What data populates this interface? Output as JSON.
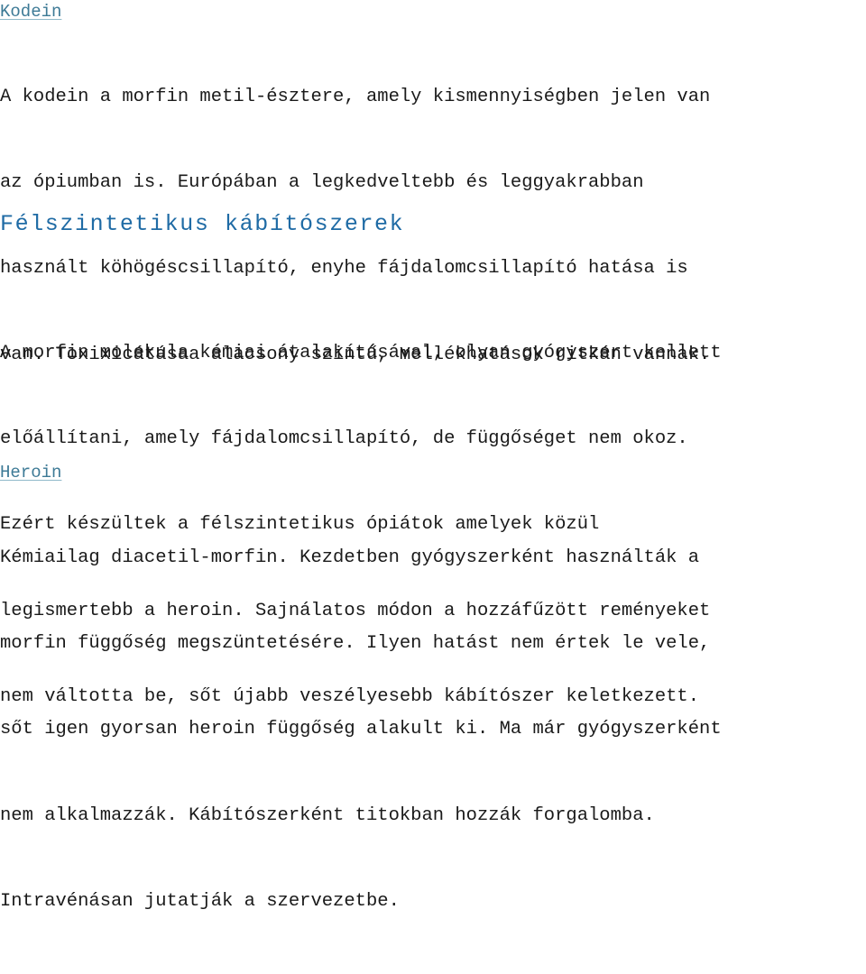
{
  "document": {
    "language": "hu",
    "colors": {
      "link": "#3d7a96",
      "link_underline": "#8fb9ca",
      "heading": "#1f6ba5",
      "body_text": "#1a1a1a",
      "background": "#ffffff"
    }
  },
  "sections": [
    {
      "id": "kodein",
      "link_label": "Kodein",
      "lines": [
        "A kodein a morfin metil-észtere, amely kismennyiségben jelen van",
        "az ópiumban is. Európában a legkedveltebb és leggyakrabban",
        "használt köhögéscsillapító, enyhe fájdalomcsillapító hatása is",
        "van. Toxixicátásaa alacsony szintű, mellékhatások ritkán vannak."
      ]
    },
    {
      "id": "felszintetikus",
      "heading": "Félszintetikus kábítószerek",
      "lines": [
        "A morfin molekula kémiai átalakításával, olyan gyógyszert kellett",
        "előállítani, amely fájdalomcsillapító, de függőséget nem okoz.",
        "Ezért készültek a félszintetikus ópiátok amelyek közül",
        "legismertebb a heroin. Sajnálatos módon a hozzáfűzött reményeket",
        "nem váltotta be, sőt újabb veszélyesebb kábítószer keletkezett."
      ]
    },
    {
      "id": "heroin",
      "link_label": "Heroin",
      "lines": [
        "Kémiailag diacetil-morfin. Kezdetben gyógyszerként használták a",
        "morfin függőség megszüntetésére. Ilyen hatást nem értek le vele,",
        "sőt igen gyorsan heroin függőség alakult ki. Ma már gyógyszerként",
        "nem alkalmazzák. Kábítószerként titokban hozzák forgalomba.",
        "Intravénásan jutatják a szervezetbe."
      ]
    }
  ]
}
